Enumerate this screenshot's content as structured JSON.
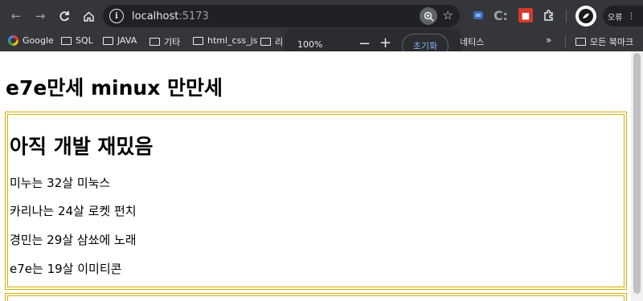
{
  "browser": {
    "url_host": "localhost",
    "url_port": ":5173",
    "profile_error": "오류",
    "bookmarks": [
      {
        "label": "Google"
      },
      {
        "label": "SQL"
      },
      {
        "label": "JAVA"
      },
      {
        "label": "기타"
      },
      {
        "label": "html_css_js"
      },
      {
        "label": "리"
      },
      {
        "label": "네티스"
      }
    ],
    "all_bookmarks": "모든 북마크",
    "zoom_popup": {
      "level": "100%",
      "minus": "−",
      "plus": "+",
      "reset_label": "초기화"
    }
  },
  "page": {
    "title": "e7e만세 minux 만만세",
    "card": {
      "title": "아직 개발 재밌음",
      "members": [
        "미누는 32살 미눅스",
        "카리나는 24살 로켓 펀치",
        "경민는 29살 삼쑈에 노래",
        "e7e는 19살 이미티콘"
      ]
    }
  },
  "colors": {
    "chrome_bg": "#35363a",
    "omnibox_bg": "#202124",
    "card_border": "#d4b000",
    "reset_text": "#8ab4f8"
  }
}
